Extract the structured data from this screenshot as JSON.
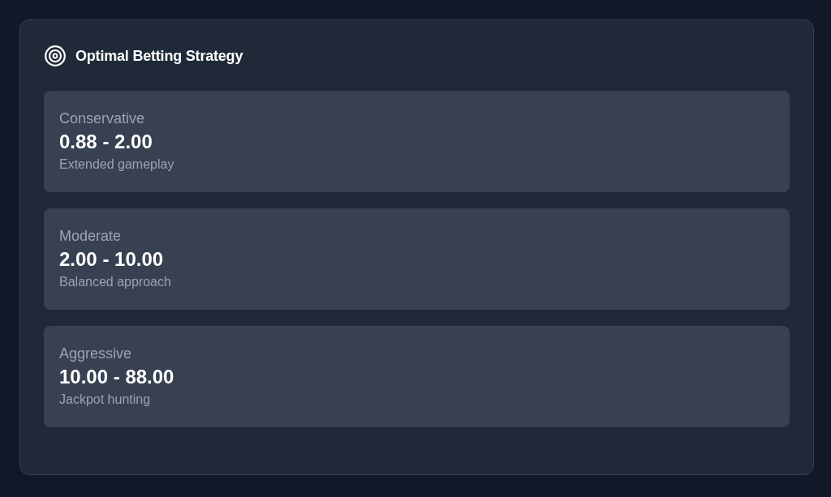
{
  "panel": {
    "title": "Optimal Betting Strategy"
  },
  "strategies": [
    {
      "name": "Conservative",
      "range": "0.88 - 2.00",
      "description": "Extended gameplay"
    },
    {
      "name": "Moderate",
      "range": "2.00 - 10.00",
      "description": "Balanced approach"
    },
    {
      "name": "Aggressive",
      "range": "10.00 - 88.00",
      "description": "Jackpot hunting"
    }
  ]
}
